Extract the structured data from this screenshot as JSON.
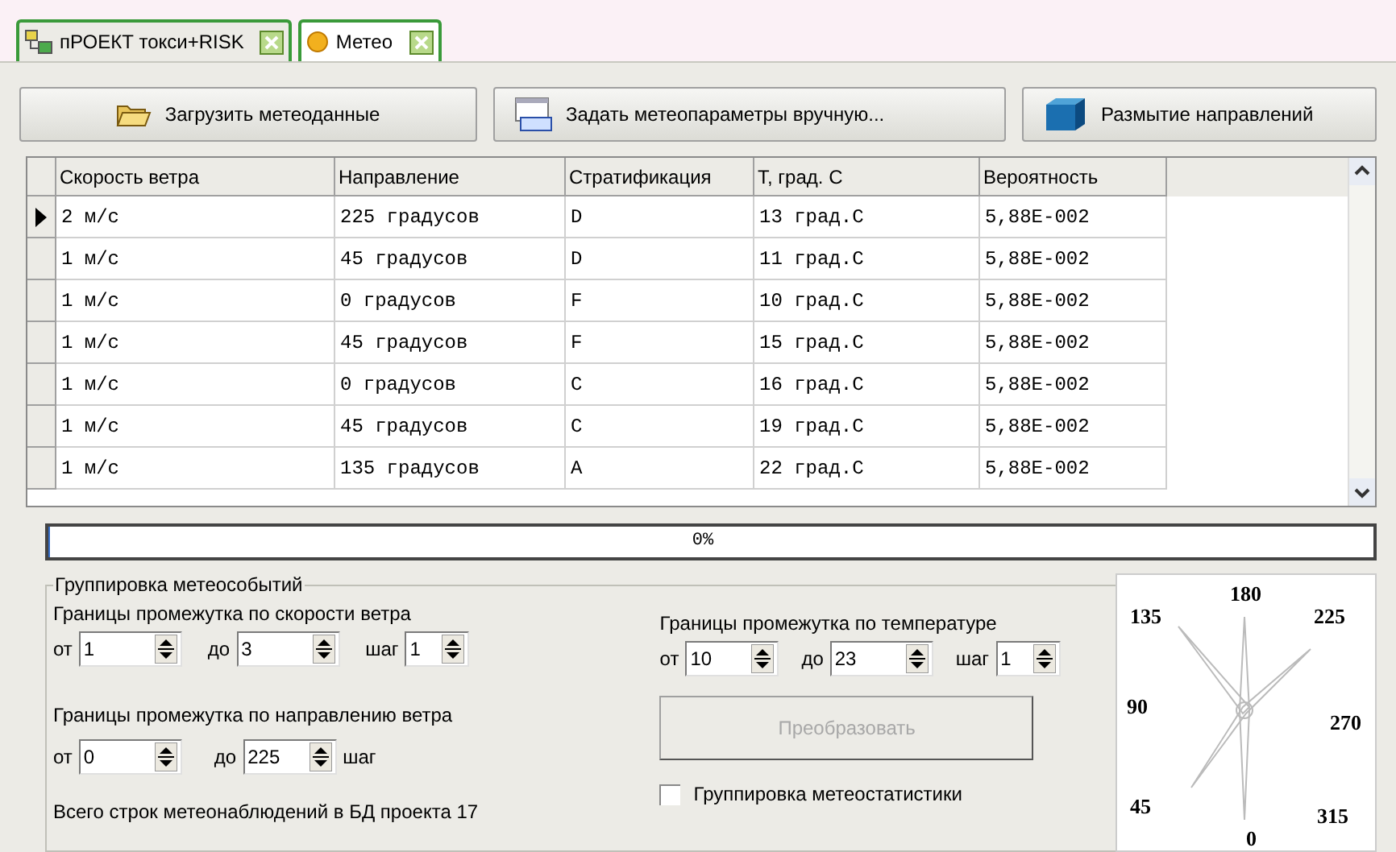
{
  "tabs": [
    {
      "label": "пРОЕКТ токси+RISK",
      "selected": false
    },
    {
      "label": "Метео",
      "selected": true
    }
  ],
  "toolbar": [
    {
      "kind": "folder",
      "label": "Загрузить метеоданные"
    },
    {
      "kind": "form",
      "label": "Задать метеопараметры вручную..."
    },
    {
      "kind": "tpu",
      "label": "Размытие направлений"
    }
  ],
  "table": {
    "columns": [
      "Скорость ветра",
      "Направление",
      "Стратификация",
      "T, град. С",
      "Вероятность"
    ],
    "rows": [
      {
        "selected": true,
        "cells": [
          "2 м/с",
          "225 градусов",
          "D",
          "13 град.С",
          "5,88E-002"
        ]
      },
      {
        "selected": false,
        "cells": [
          "1 м/с",
          "45 градусов",
          "D",
          "11 град.С",
          "5,88E-002"
        ]
      },
      {
        "selected": false,
        "cells": [
          "1 м/с",
          "0 градусов",
          "F",
          "10 град.С",
          "5,88E-002"
        ]
      },
      {
        "selected": false,
        "cells": [
          "1 м/с",
          "45 градусов",
          "F",
          "15 град.С",
          "5,88E-002"
        ]
      },
      {
        "selected": false,
        "cells": [
          "1 м/с",
          "0 градусов",
          "C",
          "16 град.С",
          "5,88E-002"
        ]
      },
      {
        "selected": false,
        "cells": [
          "1 м/с",
          "45 градусов",
          "C",
          "19 град.С",
          "5,88E-002"
        ]
      },
      {
        "selected": false,
        "cells": [
          "1 м/с",
          "135 градусов",
          "A",
          "22 град.С",
          "5,88E-002"
        ]
      }
    ]
  },
  "progress": {
    "level": 0,
    "reading": "0%"
  },
  "group": {
    "title": "Группировка метеособытий",
    "speed": {
      "label": "Границы промежутка по скорости ветра",
      "from_label": "от",
      "from": "1",
      "to_label": "до",
      "to": "3",
      "step_label": "шаг",
      "step": "1"
    },
    "direction": {
      "label": "Границы промежутка по направлению ветра",
      "from_label": "от",
      "from": "0",
      "to_label": "до",
      "to": "225",
      "step_label": "шаг"
    },
    "temperature": {
      "label": "Границы промежутка по температуре",
      "from_label": "от",
      "from": "10",
      "to_label": "до",
      "to": "23",
      "step_label": "шаг",
      "step": "1"
    },
    "convert_button": {
      "label": "Преобразовать",
      "disabled": true
    },
    "stat_checkbox": {
      "label": "Группировка метеостатистики",
      "checked": false
    },
    "total_rows": "Всего строк метеонаблюдений в БД проекта 17"
  },
  "wind_rose": {
    "labels": [
      "180",
      "135",
      "225",
      "90",
      "270",
      "45",
      "315",
      "0"
    ]
  }
}
